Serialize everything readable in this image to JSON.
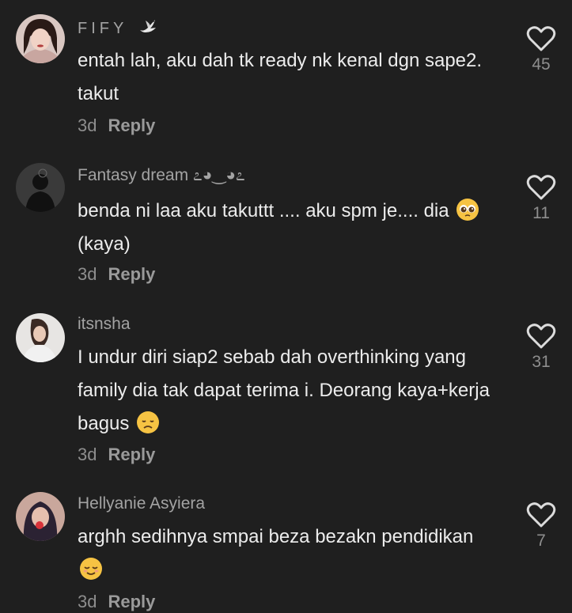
{
  "colors": {
    "background": "#1f1f1f",
    "text": "#ececec",
    "muted": "#8e8e8e"
  },
  "comments": [
    {
      "username": "FIFY",
      "username_icon": "dove-icon",
      "text": "entah lah, aku dah tk ready nk kenal dgn sape2. takut",
      "time": "3d",
      "reply": "Reply",
      "likes": "45"
    },
    {
      "username": "Fantasy dream ೭◕‿◕೭",
      "text_before": "benda ni laa aku takuttt .... aku spm je.... dia ",
      "emoji": "pleading-face-emoji",
      "text_after": "(kaya)",
      "time": "3d",
      "reply": "Reply",
      "likes": "11"
    },
    {
      "username": "itsnsha",
      "text_before": "I undur diri siap2 sebab dah overthinking yang family dia tak dapat terima i. Deorang kaya+kerja bagus ",
      "emoji": "disappointed-face-emoji",
      "time": "3d",
      "reply": "Reply",
      "likes": "31"
    },
    {
      "username": "Hellyanie Asyiera",
      "text_before": "arghh sedihnya smpai beza bezakn pendidikan ",
      "emoji": "relieved-face-emoji",
      "time": "3d",
      "reply": "Reply",
      "likes": "7"
    }
  ]
}
